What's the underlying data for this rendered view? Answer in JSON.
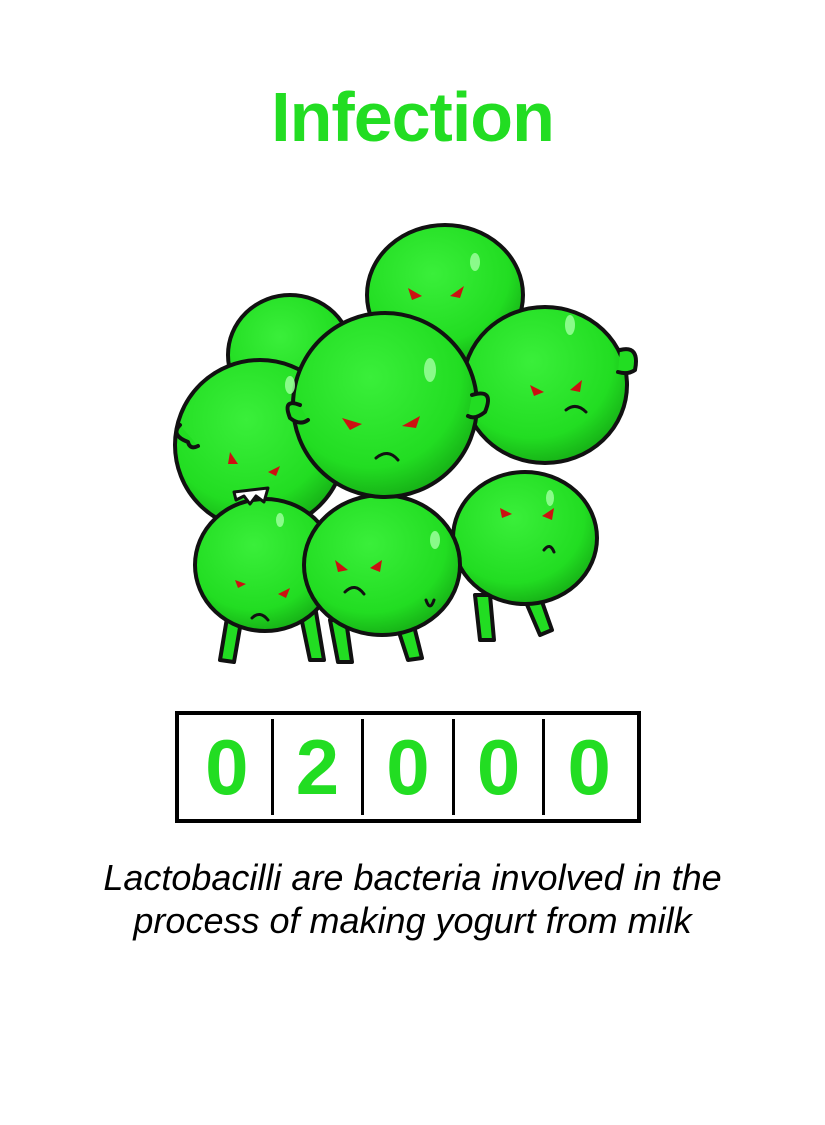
{
  "card": {
    "title": "Infection",
    "counter_digits": [
      "0",
      "2",
      "0",
      "0",
      "0"
    ],
    "description": "Lactobacilli are bacteria involved in the process of making yogurt from milk",
    "illustration_icon": "green-bacteria-cluster-icon"
  },
  "colors": {
    "accent": "#22dd22",
    "bacteria_fill": "#22dd22",
    "bacteria_shadow": "#129a12",
    "eyes": "#cc1111",
    "outline": "#111111",
    "background": "#ffffff"
  }
}
